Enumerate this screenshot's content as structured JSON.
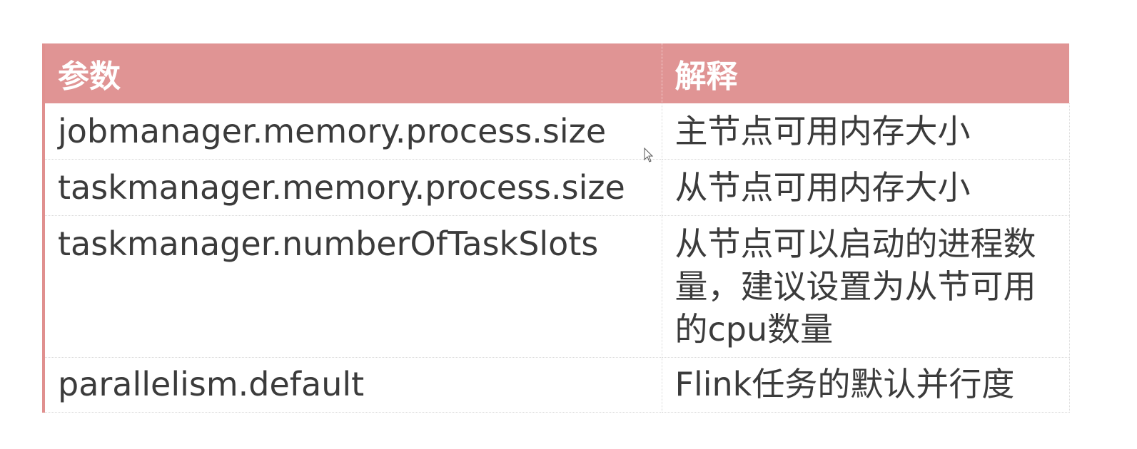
{
  "table": {
    "headers": [
      "参数",
      "解释"
    ],
    "rows": [
      {
        "param": "jobmanager.memory.process.size",
        "desc": "主节点可用内存大小"
      },
      {
        "param": "taskmanager.memory.process.size",
        "desc": "从节点可用内存大小"
      },
      {
        "param": "taskmanager.numberOfTaskSlots",
        "desc": "从节点可以启动的进程数量，建议设置为从节可用的cpu数量"
      },
      {
        "param": "parallelism.default",
        "desc": "Flink任务的默认并行度"
      }
    ]
  },
  "colors": {
    "header_bg": "#e09494",
    "header_text": "#ffffff",
    "body_text": "#3b3b3b"
  },
  "icons": {
    "cursor": "mouse-pointer-icon"
  }
}
